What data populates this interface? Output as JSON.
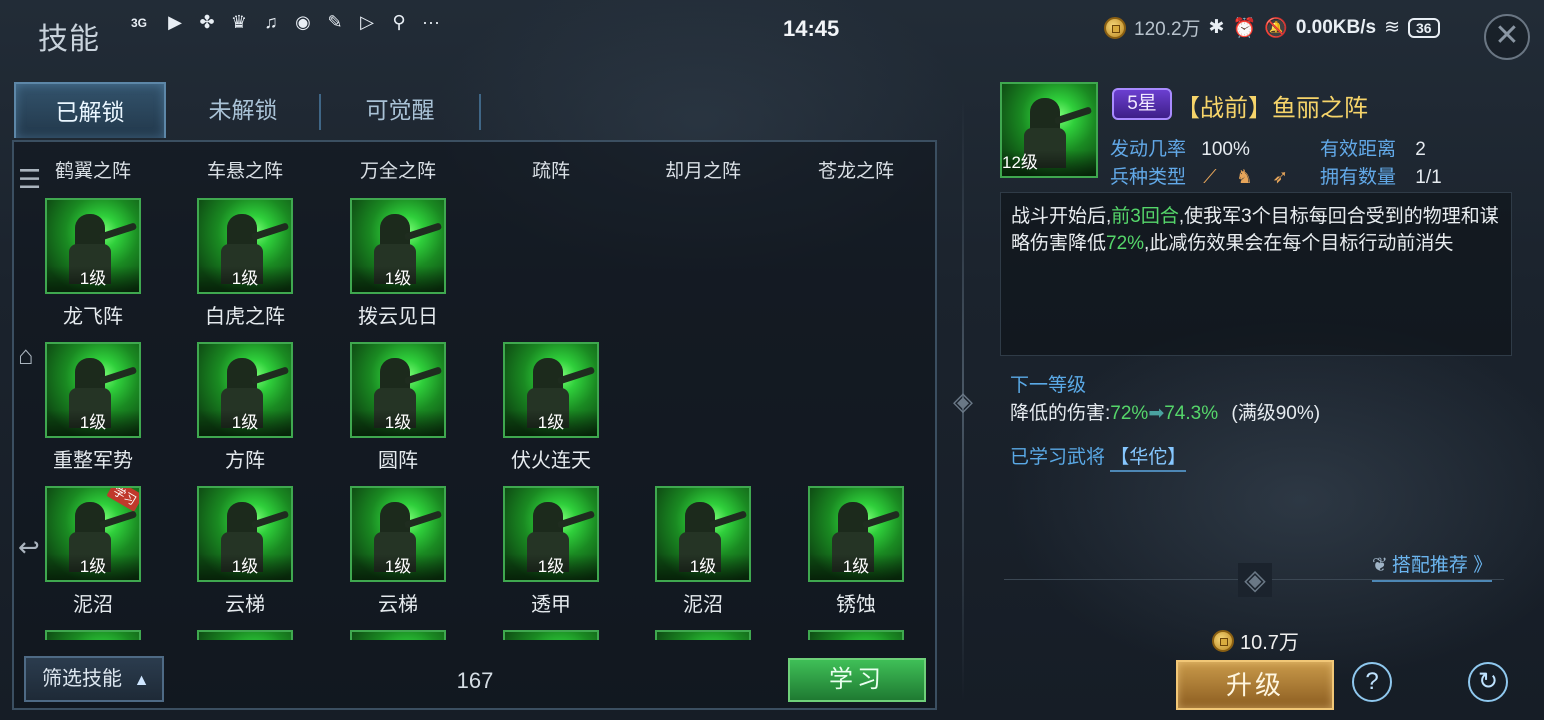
{
  "status_bar": {
    "title": "技能",
    "time": "14:45",
    "coins": "120.2万",
    "net_speed": "0.00KB/s",
    "battery": "36",
    "network": "3G"
  },
  "tabs": [
    {
      "label": "已解锁",
      "active": true
    },
    {
      "label": "未解锁",
      "active": false
    },
    {
      "label": "可觉醒",
      "active": false
    }
  ],
  "column_headers": [
    "鹤翼之阵",
    "车悬之阵",
    "万全之阵",
    "疏阵",
    "却月之阵",
    "苍龙之阵"
  ],
  "skills": [
    [
      {
        "level": "1级",
        "name": "龙飞阵"
      },
      {
        "level": "1级",
        "name": "白虎之阵"
      },
      {
        "level": "1级",
        "name": "拨云见日"
      }
    ],
    [
      {
        "level": "1级",
        "name": "重整军势"
      },
      {
        "level": "1级",
        "name": "方阵"
      },
      {
        "level": "1级",
        "name": "圆阵"
      },
      {
        "level": "1级",
        "name": "伏火连天"
      }
    ],
    [
      {
        "level": "1级",
        "name": "泥沼",
        "tag": "学习"
      },
      {
        "level": "1级",
        "name": "云梯"
      },
      {
        "level": "1级",
        "name": "云梯"
      },
      {
        "level": "1级",
        "name": "透甲"
      },
      {
        "level": "1级",
        "name": "泥沼"
      },
      {
        "level": "1级",
        "name": "锈蚀"
      }
    ]
  ],
  "bottom": {
    "filter_label": "筛选技能",
    "count": "167",
    "learn_label": "学习"
  },
  "detail": {
    "level": "12级",
    "stars": "5星",
    "name": "【战前】鱼丽之阵",
    "trigger_rate_label": "发动几率",
    "trigger_rate": "100%",
    "range_label": "有效距离",
    "range": "2",
    "troop_label": "兵种类型",
    "owned_label": "拥有数量",
    "owned": "1/1",
    "desc_1": "战斗开始后,",
    "desc_hl1": "前3回合",
    "desc_2": ",使我军3个目标每回合受到的物理和谋略伤害降低",
    "desc_hl2": "72%",
    "desc_3": ",此减伤效果会在每个目标行动前消失",
    "next_level_label": "下一等级",
    "next_line_label": "降低的伤害:",
    "next_from": "72%",
    "next_to": "74.3%",
    "next_max": "(满级90%)",
    "learned_label": "已学习武将",
    "learned_general": "【华佗】",
    "recommend_label": "搭配推荐 》",
    "cost": "10.7万",
    "upgrade_label": "升级"
  },
  "colors": {
    "accent_blue": "#5aa9e6",
    "highlight_green": "#55d66a",
    "gold": "#f6d46a",
    "card_border": "#3fa84f"
  }
}
